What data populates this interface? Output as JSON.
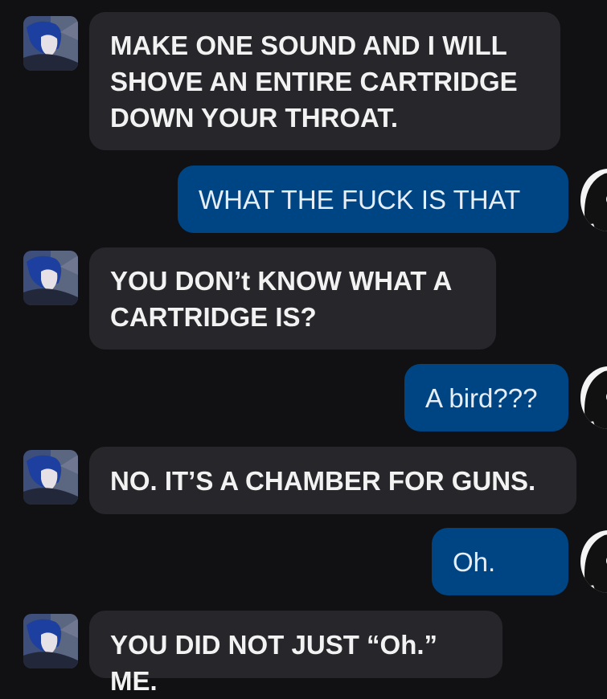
{
  "messages": [
    {
      "sender": "them",
      "text": "MAKE ONE SOUND AND I WILL\nSHOVE AN ENTIRE CARTRIDGE\nDOWN YOUR THROAT."
    },
    {
      "sender": "me",
      "text": "WHAT THE FUCK IS THAT"
    },
    {
      "sender": "them",
      "text": "YOU DON’t KNOW WHAT A\nCARTRIDGE IS?"
    },
    {
      "sender": "me",
      "text": "A bird???"
    },
    {
      "sender": "them",
      "text": "NO. IT’S A CHAMBER FOR GUNS."
    },
    {
      "sender": "me",
      "text": "Oh."
    },
    {
      "sender": "them",
      "text": "YOU DID NOT JUST “Oh.” ME."
    }
  ],
  "colors": {
    "background": "#111114",
    "incoming_bubble": "#27272b",
    "outgoing_bubble": "#004583",
    "text": "#f2f2f2"
  },
  "icons": {
    "incoming_avatar": "anime-character-avatar-icon",
    "outgoing_avatar": "black-white-character-avatar-icon"
  }
}
